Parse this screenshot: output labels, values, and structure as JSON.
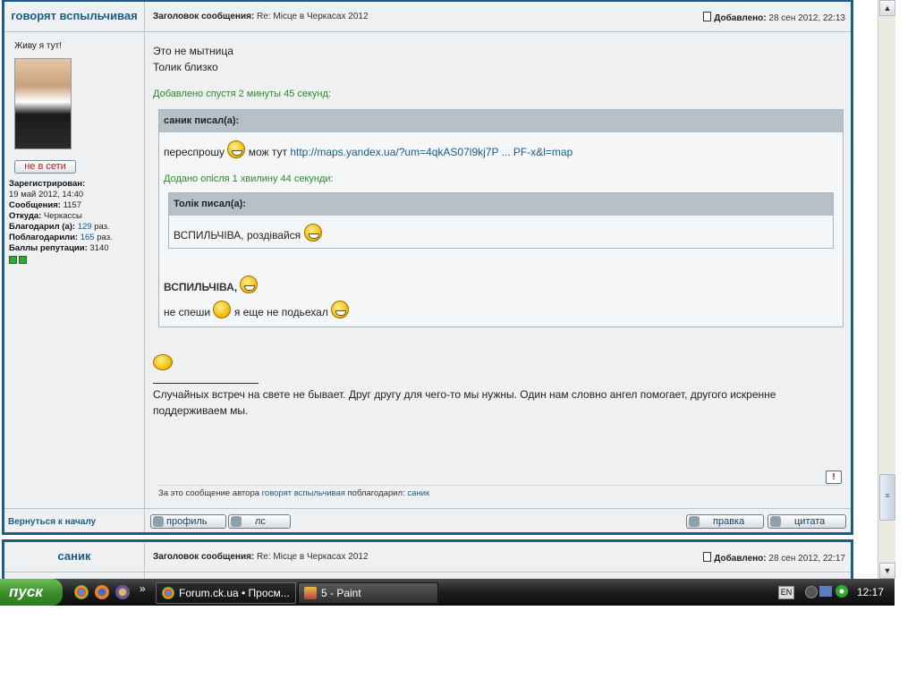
{
  "post1": {
    "author": "говорят вспыльчивая",
    "subject_label": "Заголовок сообщения:",
    "subject": "Re: Місце в Черкасах 2012",
    "added_label": "Добавлено:",
    "added_date": "28 сен 2012, 22:13",
    "motto": "Живу я тут!",
    "status": "не в сети",
    "registered_label": "Зарегистрирован:",
    "registered": "19 май 2012, 14:40",
    "messages_label": "Сообщения:",
    "messages": "1157",
    "from_label": "Откуда:",
    "from": "Черкассы",
    "thanked_label": "Благодарил (а):",
    "thanked": "129",
    "thanked_by_label": "Поблагодарили:",
    "thanked_by": "165",
    "times": "раз.",
    "rep_label": "Баллы репутации:",
    "rep": "3140",
    "line1": "Это не мытница",
    "line2": "Толик близко",
    "added_after": "Добавлено спустя 2 минуты 45 секунд:",
    "quote1_head": "саник писал(а):",
    "quote1_text": "переспрошу",
    "quote1_mid": "мож тут",
    "quote1_link": "http://maps.yandex.ua/?um=4qkAS07l9kj7P ... PF-x&l=map",
    "quote1_added": "Додано опісля 1 хвилину 44 секунди:",
    "quote2_head": "Толік писал(а):",
    "quote2_text": "ВСПИЛЬЧІВА, роздівайся",
    "reply_bold": "ВСПИЛЬЧІВА,",
    "reply_line2a": "не спеши",
    "reply_line2b": "я еще не подьехал",
    "signature": "Случайных встреч на свете не бывает. Друг другу для чего-то мы нужны. Один нам словно ангел помогает, другого искренне поддерживаем мы.",
    "thanks_text": "За это сообщение автора",
    "thanks_author": "говорят вспыльчивая",
    "thanks_verb": "поблагодарил:",
    "thanks_user": "саник",
    "back_top": "Вернуться к началу",
    "btn_profile": "профиль",
    "btn_pm": "лс",
    "btn_edit": "правка",
    "btn_quote": "цитата"
  },
  "post2": {
    "author": "саник",
    "subject_label": "Заголовок сообщения:",
    "subject": "Re: Місце в Черкасах 2012",
    "added_label": "Добавлено:",
    "added_date": "28 сен 2012, 22:17"
  },
  "taskbar": {
    "start": "пуск",
    "tasks": [
      "Forum.ck.ua • Просм...",
      "5 - Paint"
    ],
    "lang": "EN",
    "clock": "12:17",
    "overflow": "»"
  },
  "scrollbar": {
    "up": "▲",
    "down": "▼",
    "thumb": "≡"
  },
  "report_glyph": "!",
  "colors": {
    "accent": "#1a5d87",
    "added_green": "#2b8a2b",
    "quote_header": "#b7c0c7"
  }
}
